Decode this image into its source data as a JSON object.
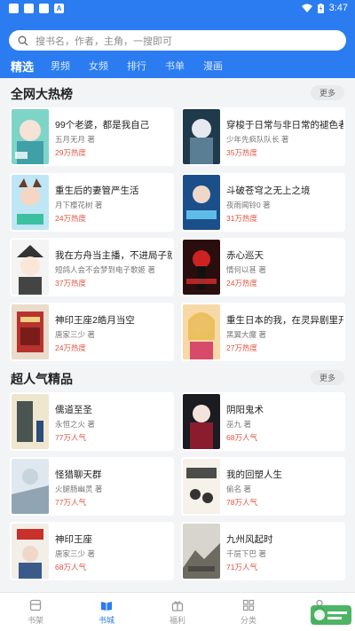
{
  "statusbar": {
    "time": "3:47",
    "battery_icon": "battery-charging-icon",
    "wifi_icon": "wifi-icon"
  },
  "search": {
    "placeholder": "搜书名，作者，主角，一搜即可"
  },
  "tabs": [
    {
      "label": "精选",
      "active": true
    },
    {
      "label": "男频"
    },
    {
      "label": "女频"
    },
    {
      "label": "排行"
    },
    {
      "label": "书单"
    },
    {
      "label": "漫画"
    }
  ],
  "hot": {
    "title": "全网大热榜",
    "more": "更多",
    "books": [
      {
        "title": "99个老婆，都是我自己",
        "author": "五月无月 著",
        "stat": "29万热度"
      },
      {
        "title": "穿梭于日常与非日常的褪色者",
        "author": "少年先疯队队长 著",
        "stat": "35万热度"
      },
      {
        "title": "重生后的妻管严生活",
        "author": "月下樱花树 著",
        "stat": "24万热度"
      },
      {
        "title": "斗破苍穹之无上之境",
        "author": "夜雨闻铃0 著",
        "stat": "31万热度"
      },
      {
        "title": "我在方舟当主播，不进局子就…",
        "author": "短鸽人会不会梦到电子歌姬 著",
        "stat": "37万热度"
      },
      {
        "title": "赤心巡天",
        "author": "情何以甚 著",
        "stat": "24万热度"
      },
      {
        "title": "神印王座2皓月当空",
        "author": "唐家三少 著",
        "stat": "24万热度"
      },
      {
        "title": "重生日本的我，在灵异剧里开…",
        "author": "黑翼大魔 著",
        "stat": "27万热度"
      }
    ]
  },
  "popular": {
    "title": "超人气精品",
    "more": "更多",
    "books": [
      {
        "title": "儒道至圣",
        "author": "永恒之火 著",
        "stat": "77万人气"
      },
      {
        "title": "阴阳鬼术",
        "author": "巫九 著",
        "stat": "68万人气"
      },
      {
        "title": "怪猎聊天群",
        "author": "火腿肠幽灵 著",
        "stat": "77万人气"
      },
      {
        "title": "我的回塑人生",
        "author": "偷名 著",
        "stat": "78万人气"
      },
      {
        "title": "神印王座",
        "author": "唐家三少 著",
        "stat": "68万人气"
      },
      {
        "title": "九州风起时",
        "author": "千层下巴 著",
        "stat": "71万人气"
      }
    ]
  },
  "nav": [
    {
      "label": "书架",
      "icon": "bookshelf-icon"
    },
    {
      "label": "书城",
      "icon": "book-open-icon",
      "active": true
    },
    {
      "label": "福利",
      "icon": "gift-icon"
    },
    {
      "label": "分类",
      "icon": "grid-icon"
    },
    {
      "label": "我的",
      "icon": "person-icon"
    }
  ],
  "colors": {
    "accent": "#2a7cf0",
    "heat": "#e25141"
  }
}
